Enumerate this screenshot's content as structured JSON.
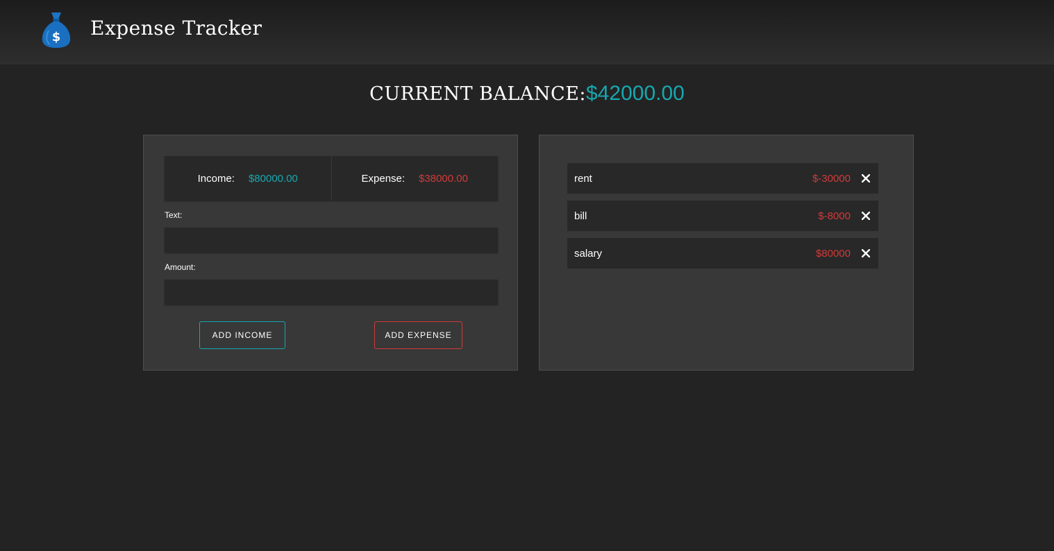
{
  "header": {
    "title": "Expense Tracker",
    "logo_icon": "money-bag-icon"
  },
  "balance": {
    "label": "CURRENT BALANCE:",
    "value": "$42000.00"
  },
  "summary": {
    "income_label": "Income:",
    "income_value": "$80000.00",
    "expense_label": "Expense:",
    "expense_value": "$38000.00"
  },
  "form": {
    "text_label": "Text:",
    "text_value": "",
    "amount_label": "Amount:",
    "amount_value": "",
    "add_income_label": "ADD INCOME",
    "add_expense_label": "ADD EXPENSE"
  },
  "transactions": [
    {
      "text": "rent",
      "amount": "$-30000"
    },
    {
      "text": "bill",
      "amount": "$-8000"
    },
    {
      "text": "salary",
      "amount": "$80000"
    }
  ],
  "colors": {
    "income": "#17a8b0",
    "expense": "#d23a3a",
    "background": "#232323",
    "panel": "#383838"
  }
}
